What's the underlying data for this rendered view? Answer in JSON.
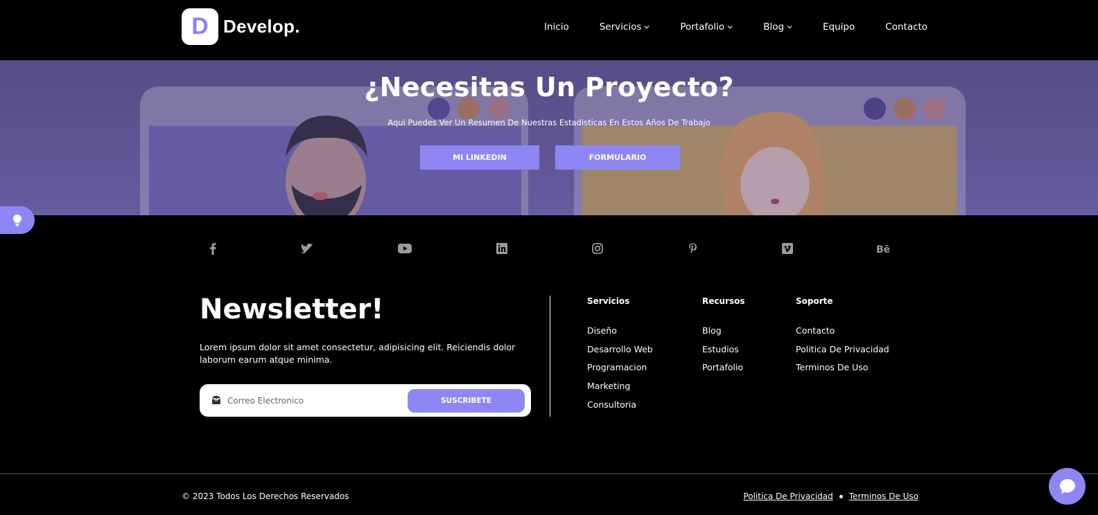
{
  "header": {
    "logo_letter": "D",
    "logo_text": "Develop.",
    "nav": [
      {
        "label": "Inicio",
        "dropdown": false
      },
      {
        "label": "Servicios",
        "dropdown": true
      },
      {
        "label": "Portafolio",
        "dropdown": true
      },
      {
        "label": "Blog",
        "dropdown": true
      },
      {
        "label": "Equipo",
        "dropdown": false
      },
      {
        "label": "Contacto",
        "dropdown": false
      }
    ]
  },
  "hero": {
    "title": "¿Necesitas Un Proyecto?",
    "subtitle": "Aqui Puedes Ver Un Resumen De Nuestras Estadisticas En Estos Años De Trabajo",
    "buttons": {
      "linkedin": "MI LINKEDIN",
      "form": "FORMULARIO"
    }
  },
  "socials": [
    "facebook-icon",
    "twitter-icon",
    "youtube-icon",
    "linkedin-icon",
    "instagram-icon",
    "pinterest-icon",
    "vimeo-icon",
    "behance-icon"
  ],
  "newsletter": {
    "title": "Newsletter!",
    "text": "Lorem ipsum dolor sit amet consectetur, adipisicing elit. Reiciendis dolor laborum earum atque minima.",
    "placeholder": "Correo Electronico",
    "button": "SUSCRIBETE"
  },
  "footer_columns": {
    "servicios": {
      "heading": "Servicios",
      "items": [
        "Diseño",
        "Desarrollo Web",
        "Programacion",
        "Marketing",
        "Consultoria"
      ]
    },
    "recursos": {
      "heading": "Recursos",
      "items": [
        "Blog",
        "Estudios",
        "Portafolio"
      ]
    },
    "soporte": {
      "heading": "Soporte",
      "items": [
        "Contacto",
        "Politica De Privacidad",
        "Terminos De Uso"
      ]
    }
  },
  "bottom": {
    "copyright": "© 2023 Todos Los Derechos Reservados",
    "privacy": "Politica De Privacidad",
    "terms": "Terminos De Uso"
  },
  "colors": {
    "accent": "#8e86f5",
    "background": "#000000",
    "hero_tint": "#6f63a4"
  }
}
